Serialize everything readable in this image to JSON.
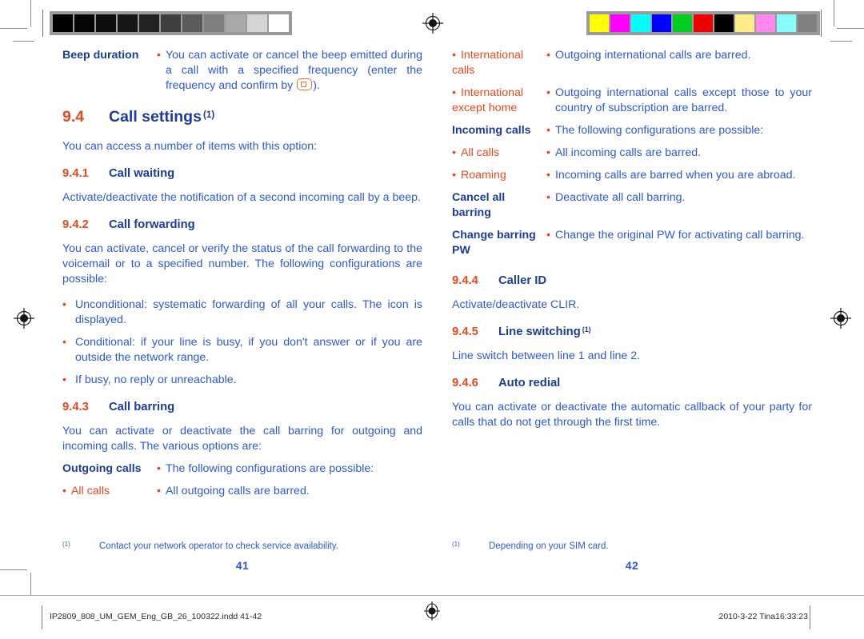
{
  "document": {
    "title": "Call settings",
    "spread_pages": [
      "41",
      "42"
    ]
  },
  "colors": {
    "number_orange": "#e8491d",
    "heading_blue": "#1b3c9b",
    "body_blue": "#2d59d8",
    "key_glyph_orange": "#ef7030"
  },
  "calibration": {
    "grayscale_strip": {
      "label": "grayscale-step-wedge",
      "patches": [
        "#000000",
        "#050505",
        "#0d0d0d",
        "#161616",
        "#212121",
        "#3f3f3f",
        "#5b5b5b",
        "#7e7e7e",
        "#a8a8a8",
        "#d4d4d4",
        "#ffffff"
      ]
    },
    "color_strip": {
      "label": "process-color-bar",
      "patches": [
        "#ffff00",
        "#ff00ff",
        "#00ffff",
        "#0000ff",
        "#00cc22",
        "#ee0000",
        "#000000",
        "#ffee88",
        "#ff88ee",
        "#88ffff",
        "#808080"
      ]
    },
    "registration_marks": 4
  },
  "left_page": {
    "intro_definition": {
      "term": "Beep duration",
      "bullet": "•",
      "desc_part1": "You can activate or cancel the beep emitted during a call with a specified frequency (enter the frequency and confirm by ",
      "desc_part2": ")."
    },
    "section": {
      "number": "9.4",
      "title": "Call settings",
      "footnote_mark": "(1)"
    },
    "section_intro": "You can access a number of items with this option:",
    "sub_9_4_1": {
      "number": "9.4.1",
      "title": "Call waiting",
      "body": "Activate/deactivate the notification of a second incoming call by a beep."
    },
    "sub_9_4_2": {
      "number": "9.4.2",
      "title": "Call forwarding",
      "body": "You can activate, cancel or verify the status of the call forwarding to the voicemail or to a specified number. The following configurations are possible:",
      "bullets": [
        "Unconditional: systematic forwarding of all your calls. The       icon is displayed.",
        "Conditional: if your line is busy, if you don't answer or if you are outside the network range.",
        "If busy, no reply or unreachable."
      ]
    },
    "sub_9_4_3": {
      "number": "9.4.3",
      "title": "Call barring",
      "body": "You can activate or deactivate the call barring for outgoing and incoming calls. The various options are:",
      "rows": [
        {
          "term": "Outgoing calls",
          "term_style": "bold",
          "desc": "The following configurations are possible:"
        },
        {
          "term": "All calls",
          "term_style": "sub",
          "desc": "All outgoing calls are barred."
        }
      ]
    },
    "footnote": {
      "mark": "(1)",
      "text": "Contact your network operator to check service availability."
    },
    "folio": "41"
  },
  "right_page": {
    "barring_rows_continued": [
      {
        "term": "International calls",
        "term_style": "sub",
        "desc": "Outgoing international calls are barred."
      },
      {
        "term": "International except home",
        "term_style": "sub",
        "desc": "Outgoing international calls except those to your country of subscription are barred."
      },
      {
        "term": "Incoming calls",
        "term_style": "bold",
        "desc": "The following configurations are possible:"
      },
      {
        "term": "All calls",
        "term_style": "sub",
        "desc": "All incoming calls are barred."
      },
      {
        "term": "Roaming",
        "term_style": "sub",
        "desc": "Incoming calls are barred when you are abroad."
      },
      {
        "term": "Cancel all barring",
        "term_style": "bold",
        "desc": "Deactivate all call barring."
      },
      {
        "term": "Change barring PW",
        "term_style": "bold",
        "desc": "Change the original PW for activating call barring."
      }
    ],
    "sub_9_4_4": {
      "number": "9.4.4",
      "title": "Caller ID",
      "body": "Activate/deactivate CLIR."
    },
    "sub_9_4_5": {
      "number": "9.4.5",
      "title": "Line switching",
      "footnote_mark": "(1)",
      "body": "Line switch between line 1 and line 2."
    },
    "sub_9_4_6": {
      "number": "9.4.6",
      "title": "Auto redial",
      "body": "You can activate or deactivate the automatic callback of your party for calls that do not get through the first time."
    },
    "footnote": {
      "mark": "(1)",
      "text": "Depending on your SIM card."
    },
    "folio": "42"
  },
  "slug": {
    "filename": "IP2809_808_UM_GEM_Eng_GB_26_100322.indd   41-42",
    "datetime": "2010-3-22   Tina16:33:23"
  }
}
